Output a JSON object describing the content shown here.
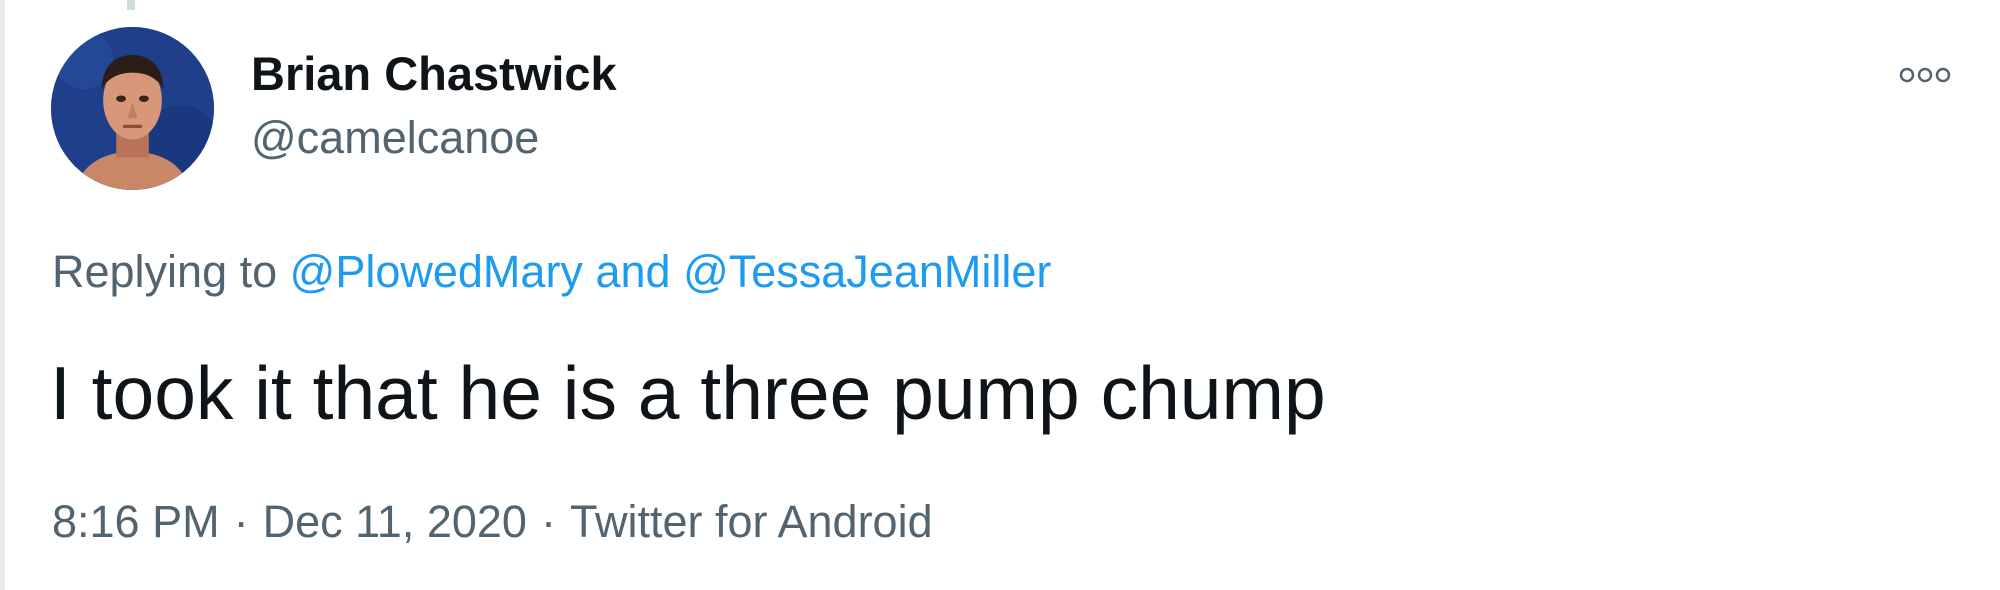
{
  "tweet": {
    "author": {
      "display_name": "Brian Chastwick",
      "handle": "@camelcanoe",
      "avatar_icon": "avatar-portrait-icon"
    },
    "more_icon": "more-options-icon",
    "reply_context": {
      "prefix": "Replying to",
      "mention_1": "@PlowedMary",
      "joiner": "and",
      "mention_2": "@TessaJeanMiller"
    },
    "text": "I took it that he is a three pump chump",
    "timestamp": {
      "time": "8:16 PM",
      "separator": "·",
      "date": "Dec 11, 2020",
      "source": "Twitter for Android"
    }
  },
  "colors": {
    "text_primary": "#0f1419",
    "text_secondary": "#536471",
    "link": "#1d9bf0",
    "avatar_bg": "#1f3f8a"
  }
}
